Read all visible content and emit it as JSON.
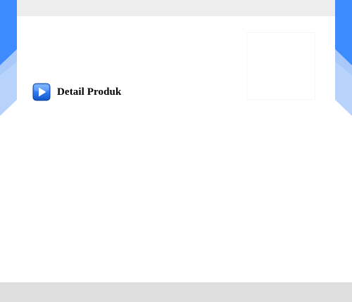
{
  "section": {
    "title": "Detail Produk",
    "icon": "play-icon"
  },
  "colors": {
    "accent_blue": "#3d8bff",
    "accent_blue_light": "#a9c9fb",
    "top_strip": "#ededed",
    "footer": "#dedede"
  }
}
